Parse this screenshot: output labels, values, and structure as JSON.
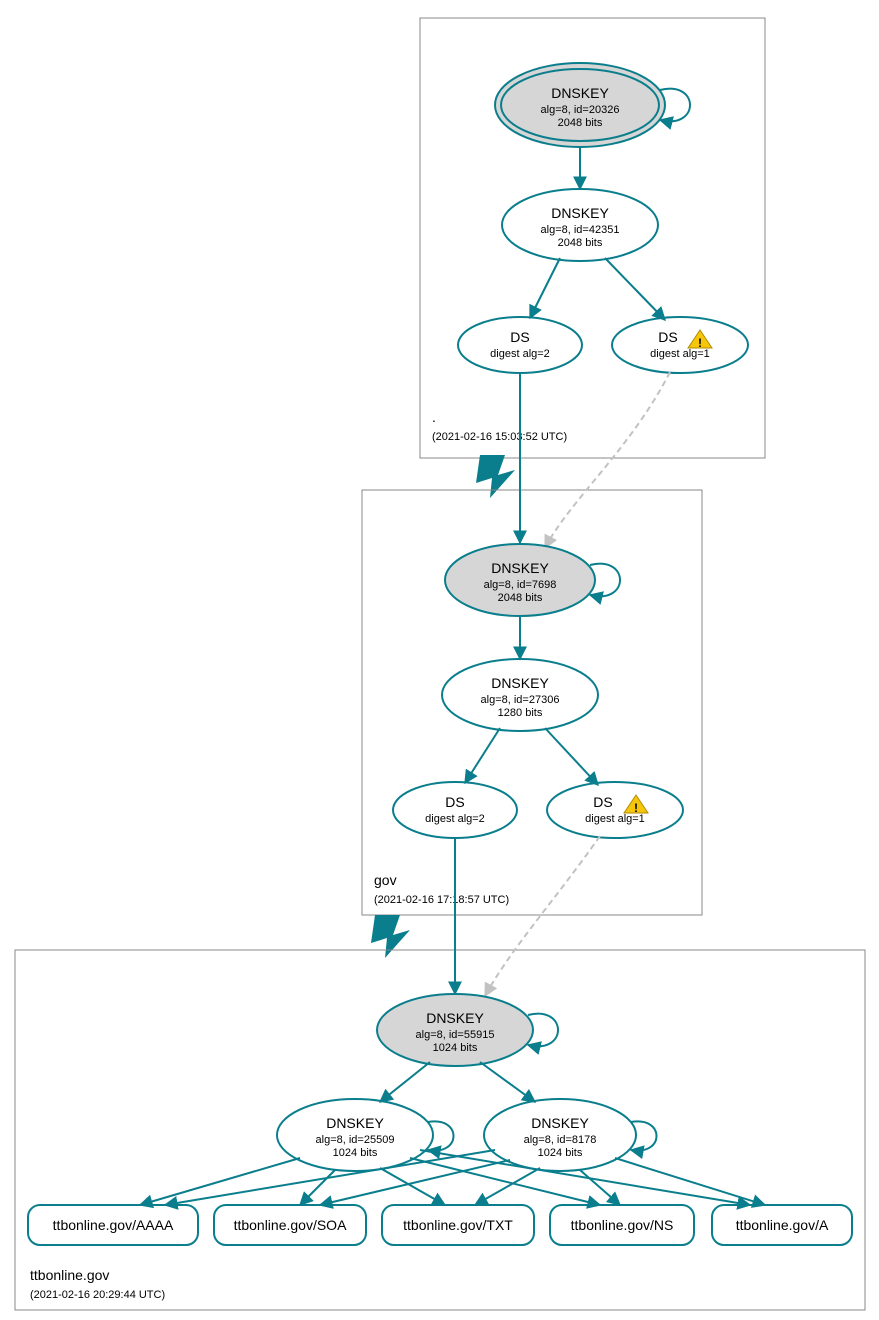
{
  "zones": {
    "root": {
      "label": ".",
      "timestamp": "(2021-02-16 15:03:52 UTC)",
      "nodes": {
        "ksk": {
          "title": "DNSKEY",
          "line1": "alg=8, id=20326",
          "line2": "2048 bits"
        },
        "zsk": {
          "title": "DNSKEY",
          "line1": "alg=8, id=42351",
          "line2": "2048 bits"
        },
        "ds1": {
          "title": "DS",
          "line1": "digest alg=2"
        },
        "ds2": {
          "title": "DS",
          "line1": "digest alg=1",
          "warn": true
        }
      }
    },
    "gov": {
      "label": "gov",
      "timestamp": "(2021-02-16 17:18:57 UTC)",
      "nodes": {
        "ksk": {
          "title": "DNSKEY",
          "line1": "alg=8, id=7698",
          "line2": "2048 bits"
        },
        "zsk": {
          "title": "DNSKEY",
          "line1": "alg=8, id=27306",
          "line2": "1280 bits"
        },
        "ds1": {
          "title": "DS",
          "line1": "digest alg=2"
        },
        "ds2": {
          "title": "DS",
          "line1": "digest alg=1",
          "warn": true
        }
      }
    },
    "domain": {
      "label": "ttbonline.gov",
      "timestamp": "(2021-02-16 20:29:44 UTC)",
      "nodes": {
        "ksk": {
          "title": "DNSKEY",
          "line1": "alg=8, id=55915",
          "line2": "1024 bits"
        },
        "zsk1": {
          "title": "DNSKEY",
          "line1": "alg=8, id=25509",
          "line2": "1024 bits"
        },
        "zsk2": {
          "title": "DNSKEY",
          "line1": "alg=8, id=8178",
          "line2": "1024 bits"
        }
      },
      "rrsets": {
        "aaaa": "ttbonline.gov/AAAA",
        "soa": "ttbonline.gov/SOA",
        "txt": "ttbonline.gov/TXT",
        "ns": "ttbonline.gov/NS",
        "a": "ttbonline.gov/A"
      }
    }
  }
}
